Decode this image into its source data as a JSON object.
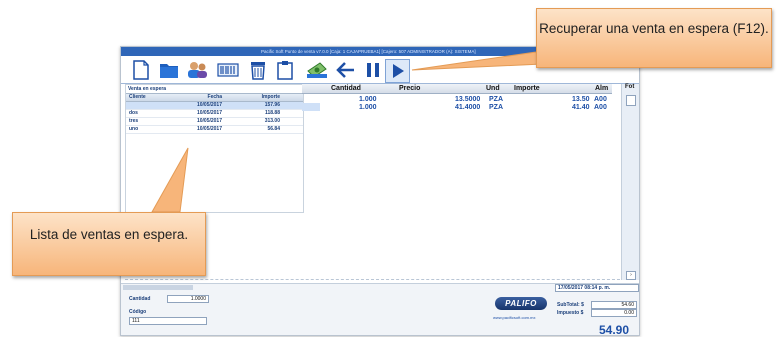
{
  "window": {
    "title": "Pacific Soft Punto de venta v7.0.0   [Caja: 1 CAJAPRUEBA1]   [Cajero: 507 ADMINISTRADOR (A): SISTEMA]"
  },
  "toolbar": {
    "buttons": [
      {
        "icon": "new-document-icon"
      },
      {
        "icon": "folder-icon"
      },
      {
        "icon": "customers-icon"
      },
      {
        "icon": "barcode-card-icon"
      },
      {
        "icon": "trash-icon"
      },
      {
        "icon": "paste-document-icon"
      },
      {
        "icon": "cash-icon"
      },
      {
        "icon": "back-arrow-icon"
      },
      {
        "icon": "pause-icon"
      },
      {
        "icon": "play-icon"
      }
    ]
  },
  "waiting_sales": {
    "title": "Venta en espera",
    "columns": [
      "Cliente",
      "Fecha",
      "Importe"
    ],
    "rows": [
      {
        "cliente": "",
        "fecha": "10/05/2017",
        "importe": "157.96"
      },
      {
        "cliente": "dos",
        "fecha": "10/05/2017",
        "importe": "118.88"
      },
      {
        "cliente": "tres",
        "fecha": "10/05/2017",
        "importe": "313.00"
      },
      {
        "cliente": "uno",
        "fecha": "10/05/2017",
        "importe": "56.84"
      }
    ]
  },
  "sale_grid": {
    "columns": [
      "Cantidad",
      "Precio",
      "Und",
      "Importe",
      "Alm"
    ],
    "rows": [
      {
        "cantidad": "1.000",
        "precio": "13.5000",
        "und": "PZA",
        "importe": "13.50",
        "alm": "A00"
      },
      {
        "cantidad": "1.000",
        "precio": "41.4000",
        "und": "PZA",
        "importe": "41.40",
        "alm": "A00"
      }
    ],
    "corner_text": "Fot"
  },
  "bottom": {
    "cantidad_label": "Cantidad",
    "cantidad_value": "1.0000",
    "codigo_label": "Código",
    "codigo_value": "111",
    "datetime": "17/05/2017  08:14 p. m.",
    "subtotal_label": "SubTotal: $",
    "subtotal_value": "54.60",
    "impuesto_label": "Impuesto $",
    "impuesto_value": "0.00",
    "total": "54.90",
    "logo_text": "PALIFO",
    "website": "www.pacificsoft.com.mx"
  },
  "callouts": {
    "recover": "Recuperar una venta en espera (F12).",
    "list": "Lista de ventas en espera."
  },
  "colors": {
    "accent": "#1d4fa6",
    "titlebar": "#2f66b8",
    "callout": "#f7b57a"
  }
}
